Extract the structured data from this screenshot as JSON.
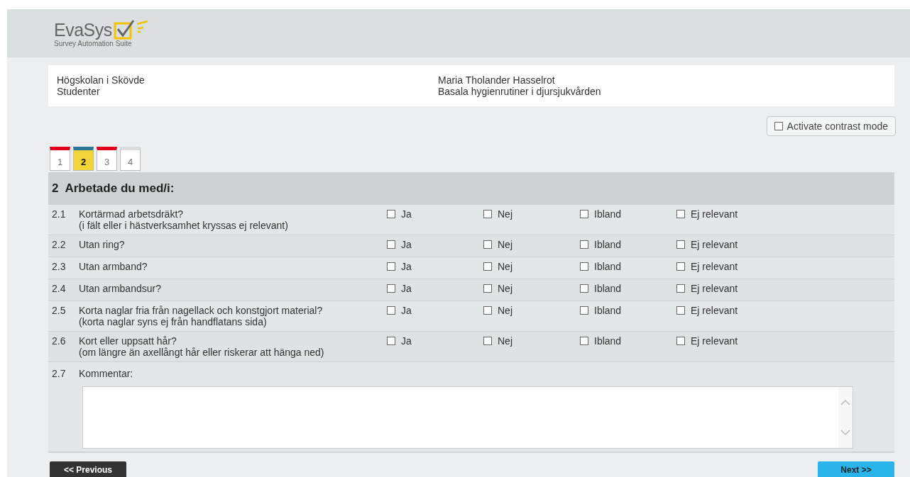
{
  "logo": {
    "name": "EvaSys",
    "tagline": "Survey Automation Suite"
  },
  "info": {
    "left": [
      "Högskolan i Skövde",
      "Studenter"
    ],
    "right": [
      "Maria Tholander Hasselrot",
      "Basala hygienrutiner i djursjukvården"
    ]
  },
  "contrast_mode": {
    "label": "Activate contrast mode",
    "checked": false
  },
  "page_tabs": [
    {
      "label": "1",
      "selected": false,
      "color": "#e2001a"
    },
    {
      "label": "2",
      "selected": true,
      "color": "#2c7896"
    },
    {
      "label": "3",
      "selected": false,
      "color": "#e2001a"
    },
    {
      "label": "4",
      "selected": false,
      "color": "#dcdddd"
    }
  ],
  "section": {
    "number": "2",
    "title": "Arbetade du med/i:"
  },
  "questions": [
    {
      "number": "2.1",
      "text": "Kortärmad arbetsdräkt?",
      "note": "(i fält eller i hästverksamhet kryssas ej relevant)",
      "options": [
        {
          "label": "Ja",
          "checked": false
        },
        {
          "label": "Nej",
          "checked": false
        },
        {
          "label": "Ibland",
          "checked": false
        },
        {
          "label": "Ej relevant",
          "checked": false
        }
      ]
    },
    {
      "number": "2.2",
      "text": "Utan ring?",
      "options": [
        {
          "label": "Ja",
          "checked": false
        },
        {
          "label": "Nej",
          "checked": false
        },
        {
          "label": "Ibland",
          "checked": false
        },
        {
          "label": "Ej relevant",
          "checked": false
        }
      ]
    },
    {
      "number": "2.3",
      "text": "Utan armband?",
      "options": [
        {
          "label": "Ja",
          "checked": false
        },
        {
          "label": "Nej",
          "checked": false
        },
        {
          "label": "Ibland",
          "checked": false
        },
        {
          "label": "Ej relevant",
          "checked": false
        }
      ]
    },
    {
      "number": "2.4",
      "text": "Utan armbandsur?",
      "options": [
        {
          "label": "Ja",
          "checked": false
        },
        {
          "label": "Nej",
          "checked": false
        },
        {
          "label": "Ibland",
          "checked": false
        },
        {
          "label": "Ej relevant",
          "checked": false
        }
      ]
    },
    {
      "number": "2.5",
      "text": "Korta naglar fria från nagellack och konstgjort material?",
      "note": "(korta naglar syns ej från handflatans sida)",
      "options": [
        {
          "label": "Ja",
          "checked": false
        },
        {
          "label": "Nej",
          "checked": false
        },
        {
          "label": "Ibland",
          "checked": false
        },
        {
          "label": "Ej relevant",
          "checked": false
        }
      ]
    },
    {
      "number": "2.6",
      "text": "Kort eller uppsatt hår?",
      "note": "(om längre än axellångt hår eller riskerar att hänga ned)",
      "options": [
        {
          "label": "Ja",
          "checked": false
        },
        {
          "label": "Nej",
          "checked": false
        },
        {
          "label": "Ibland",
          "checked": false
        },
        {
          "label": "Ej relevant",
          "checked": false
        }
      ]
    }
  ],
  "comment": {
    "number": "2.7",
    "label": "Kommentar:"
  },
  "buttons": {
    "previous": "<< Previous",
    "next": "Next >>"
  }
}
